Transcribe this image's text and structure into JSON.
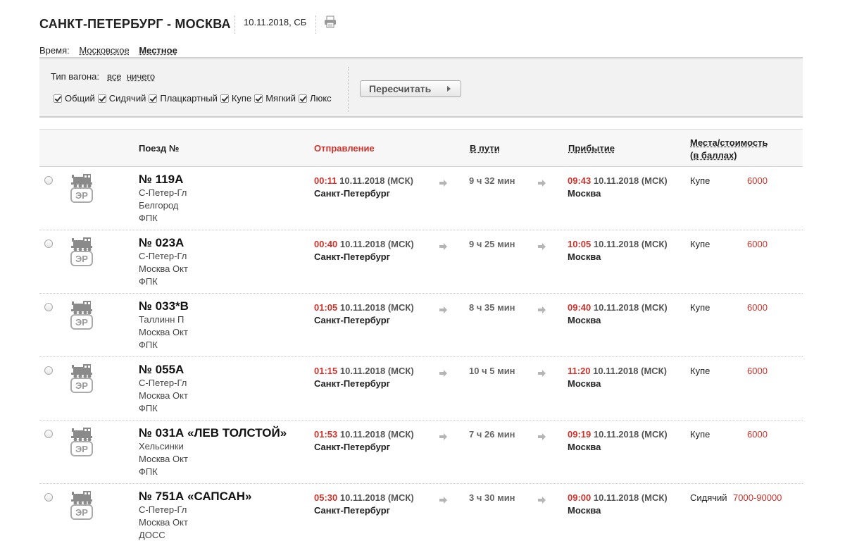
{
  "header": {
    "route_title": "САНКТ-ПЕТЕРБУРГ - МОСКВА",
    "date": "10.11.2018, СБ",
    "time_label": "Время:",
    "time_moscow": "Московское",
    "time_local": "Местное"
  },
  "filter": {
    "wagon_type_label": "Тип вагона:",
    "all_link": "все",
    "none_link": "ничего",
    "types": [
      "Общий",
      "Сидячий",
      "Плацкартный",
      "Купе",
      "Мягкий",
      "Люкс"
    ],
    "recalc_label": "Пересчитать"
  },
  "table": {
    "col_train": "Поезд №",
    "col_departure": "Отправление",
    "col_travel": "В пути",
    "col_arrival": "Прибытие",
    "col_seats_1": "Места/стоимость",
    "col_seats_2": "(в баллах)"
  },
  "loco_badge": "ЭР",
  "rows": [
    {
      "number": "№ 119А",
      "line1": "С-Петер-Гл",
      "line2": "Белгород",
      "line3": "ФПК",
      "dep_time": "00:11",
      "dep_date": "10.11.2018 (МСК)",
      "dep_station": "Санкт-Петербург",
      "duration": "9 ч 32 мин",
      "arr_time": "09:43",
      "arr_date": "10.11.2018 (МСК)",
      "arr_station": "Москва",
      "car_type": "Купе",
      "price": "6000"
    },
    {
      "number": "№ 023А",
      "line1": "С-Петер-Гл",
      "line2": "Москва Окт",
      "line3": "ФПК",
      "dep_time": "00:40",
      "dep_date": "10.11.2018 (МСК)",
      "dep_station": "Санкт-Петербург",
      "duration": "9 ч 25 мин",
      "arr_time": "10:05",
      "arr_date": "10.11.2018 (МСК)",
      "arr_station": "Москва",
      "car_type": "Купе",
      "price": "6000"
    },
    {
      "number": "№ 033*В",
      "line1": "Таллинн П",
      "line2": "Москва Окт",
      "line3": "ФПК",
      "dep_time": "01:05",
      "dep_date": "10.11.2018 (МСК)",
      "dep_station": "Санкт-Петербург",
      "duration": "8 ч 35 мин",
      "arr_time": "09:40",
      "arr_date": "10.11.2018 (МСК)",
      "arr_station": "Москва",
      "car_type": "Купе",
      "price": "6000"
    },
    {
      "number": "№ 055А",
      "line1": "С-Петер-Гл",
      "line2": "Москва Окт",
      "line3": "ФПК",
      "dep_time": "01:15",
      "dep_date": "10.11.2018 (МСК)",
      "dep_station": "Санкт-Петербург",
      "duration": "10 ч 5 мин",
      "arr_time": "11:20",
      "arr_date": "10.11.2018 (МСК)",
      "arr_station": "Москва",
      "car_type": "Купе",
      "price": "6000"
    },
    {
      "number": "№ 031А «ЛЕВ ТОЛСТОЙ»",
      "line1": "Хельсинки",
      "line2": "Москва Окт",
      "line3": "ФПК",
      "dep_time": "01:53",
      "dep_date": "10.11.2018 (МСК)",
      "dep_station": "Санкт-Петербург",
      "duration": "7 ч 26 мин",
      "arr_time": "09:19",
      "arr_date": "10.11.2018 (МСК)",
      "arr_station": "Москва",
      "car_type": "Купе",
      "price": "6000"
    },
    {
      "number": "№ 751А «САПСАН»",
      "line1": "С-Петер-Гл",
      "line2": "Москва Окт",
      "line3": "ДОСС",
      "dep_time": "05:30",
      "dep_date": "10.11.2018 (МСК)",
      "dep_station": "Санкт-Петербург",
      "duration": "3 ч 30 мин",
      "arr_time": "09:00",
      "arr_date": "10.11.2018 (МСК)",
      "arr_station": "Москва",
      "car_type": "Сидячий",
      "price": "7000-90000"
    }
  ]
}
